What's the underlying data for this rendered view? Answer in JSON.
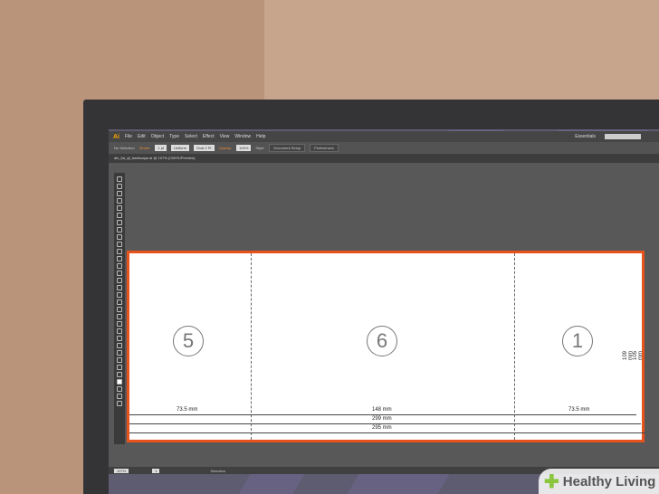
{
  "app": {
    "logo": "Ai",
    "menu": [
      "File",
      "Edit",
      "Object",
      "Type",
      "Select",
      "Effect",
      "View",
      "Window",
      "Help"
    ],
    "workspace": "Essentials"
  },
  "control": {
    "selection": "No Selection",
    "stroke_label": "Stroke:",
    "stroke_value": "1 pt",
    "brush": "Uniform",
    "profile": "Oval 2 Pt",
    "opacity_label": "Opacity:",
    "opacity_value": "100%",
    "style_label": "Style:",
    "doc_setup": "Document Setup",
    "preferences": "Preferences"
  },
  "tab": {
    "title": "afc_6a_qf_landscape.ai @ 107% (CMYK/Preview)"
  },
  "artboard": {
    "panels": [
      "5",
      "6",
      "1"
    ],
    "dims": {
      "left": "73.5 mm",
      "middle": "148 mm",
      "right": "73.5 mm",
      "total1": "299 mm",
      "total2": "295 mm",
      "height1": "109 mm",
      "height2": "105 mm"
    }
  },
  "status": {
    "zoom": "107%",
    "page": "1",
    "tool": "Selection"
  },
  "watermark": {
    "text": "Healthy Living"
  },
  "colors": {
    "bleed": "#e8521c",
    "accent": "#f7a600"
  }
}
